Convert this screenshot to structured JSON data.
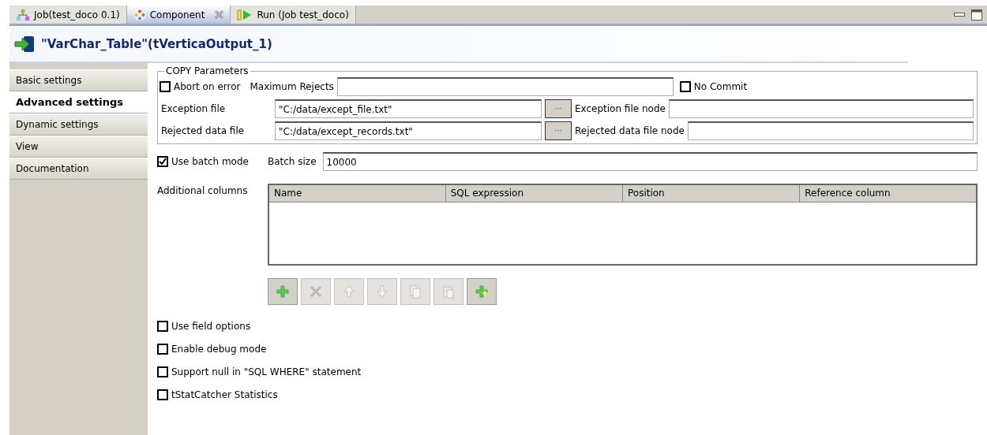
{
  "tabs": [
    {
      "label": "Job(test_doco 0.1)",
      "kind": "job",
      "selected": false,
      "closable": false
    },
    {
      "label": "Component",
      "kind": "component",
      "selected": true,
      "closable": true
    },
    {
      "label": "Run (Job test_doco)",
      "kind": "run",
      "selected": false,
      "closable": false
    }
  ],
  "header": {
    "title": "\"VarChar_Table\"(tVerticaOutput_1)"
  },
  "sidebar": {
    "items": [
      {
        "label": "Basic settings",
        "selected": false
      },
      {
        "label": "Advanced settings",
        "selected": true
      },
      {
        "label": "Dynamic settings",
        "selected": false
      },
      {
        "label": "View",
        "selected": false
      },
      {
        "label": "Documentation",
        "selected": false
      }
    ]
  },
  "copy_parameters": {
    "legend": "COPY Parameters",
    "abort_on_error": {
      "label": "Abort on error",
      "checked": false
    },
    "maximum_rejects": {
      "label": "Maximum Rejects"
    },
    "no_commit": {
      "label": "No Commit",
      "checked": false
    },
    "files": [
      {
        "label": "Exception file",
        "value": "\"C:/data/except_file.txt\"",
        "browse": "···",
        "node_label": "Exception file node"
      },
      {
        "label": "Rejected data file",
        "value": "\"C:/data/except_records.txt\"",
        "browse": "···",
        "node_label": "Rejected data file node"
      }
    ]
  },
  "batch": {
    "label": "Use batch mode",
    "checked": true,
    "size_label": "Batch size",
    "size_value": "10000"
  },
  "additional_columns": {
    "label": "Additional columns",
    "columns": [
      "Name",
      "SQL expression",
      "Position",
      "Reference column"
    ],
    "toolbar": [
      {
        "kind": "add",
        "disabled": false
      },
      {
        "kind": "remove",
        "disabled": true
      },
      {
        "kind": "up",
        "disabled": true
      },
      {
        "kind": "down",
        "disabled": true
      },
      {
        "kind": "copy",
        "disabled": true
      },
      {
        "kind": "paste",
        "disabled": true
      },
      {
        "kind": "add-multiple",
        "disabled": false
      }
    ]
  },
  "options": [
    {
      "label": "Use field options",
      "checked": false
    },
    {
      "label": "Enable debug mode",
      "checked": false
    },
    {
      "label": "Support null in \"SQL WHERE\" statement",
      "checked": false
    },
    {
      "label": "tStatCatcher Statistics",
      "checked": false
    }
  ]
}
